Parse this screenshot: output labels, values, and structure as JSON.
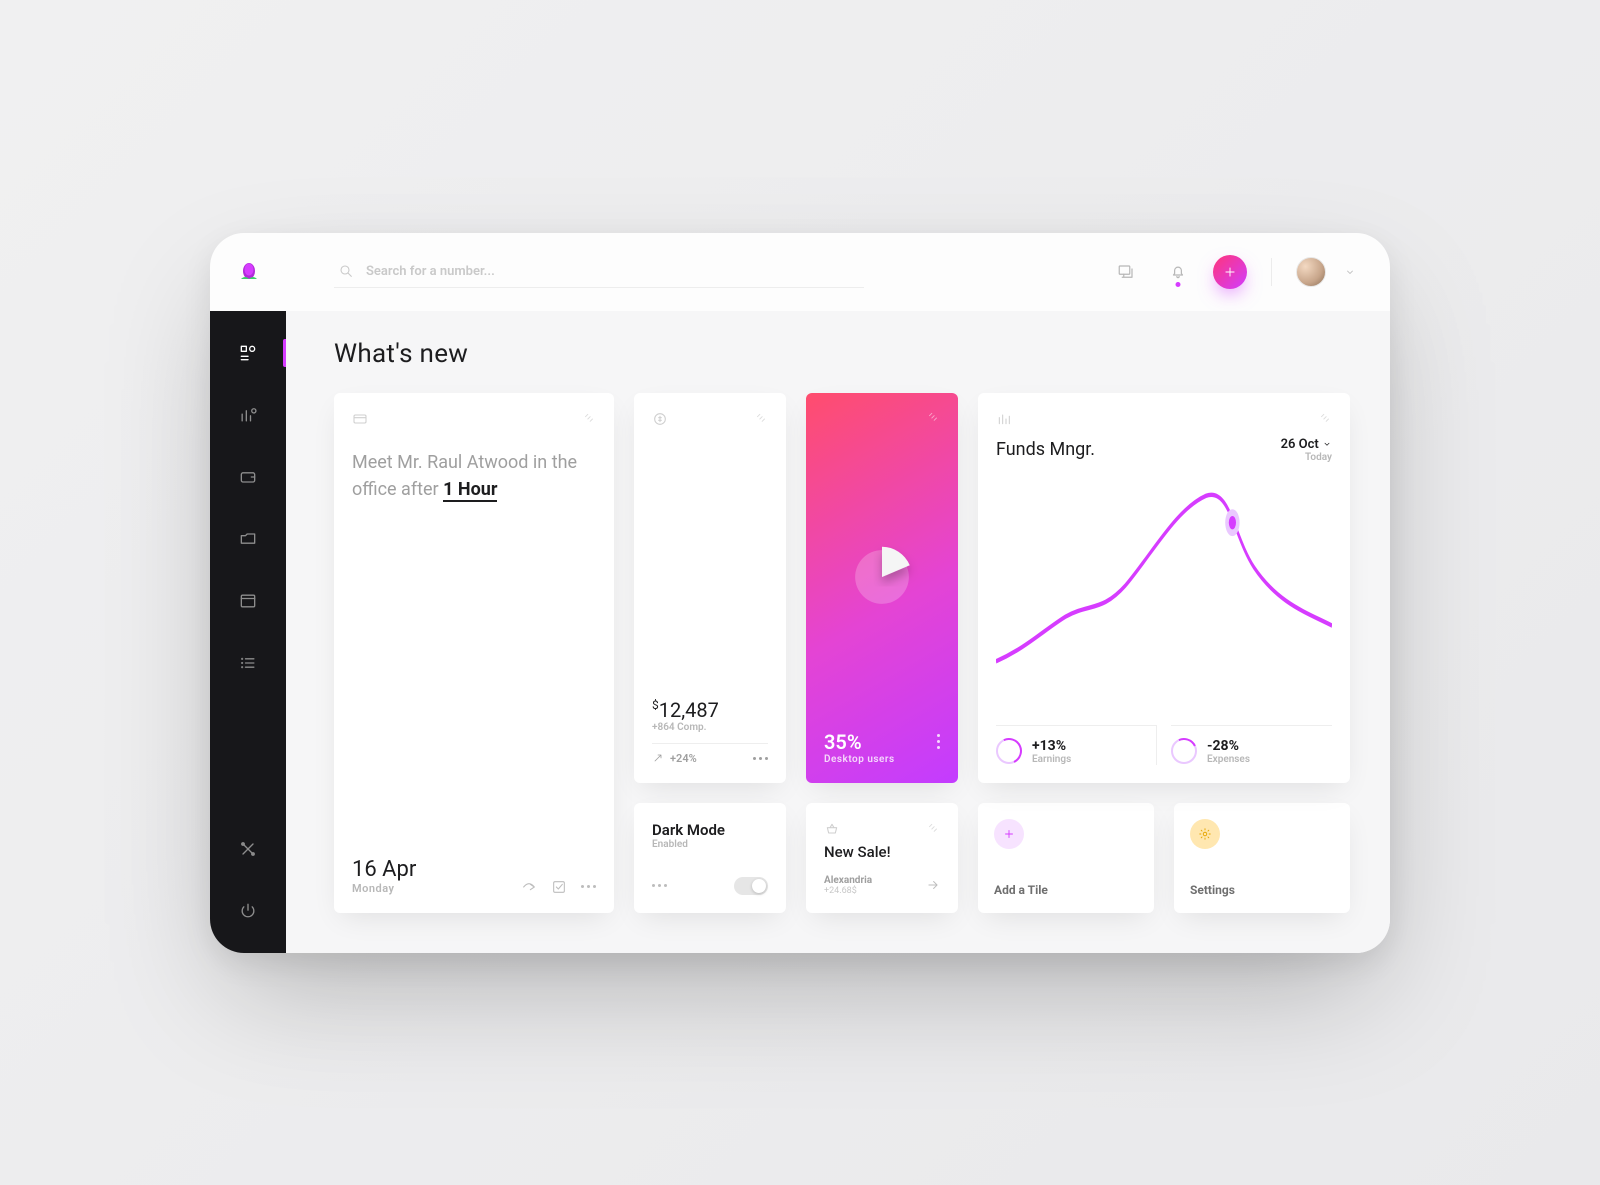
{
  "colors": {
    "accent": "#d63cff",
    "accentSoft": "#f7e3ff",
    "gold": "#e5a500",
    "goldSoft": "#ffe7b0"
  },
  "search": {
    "placeholder": "Search for a number..."
  },
  "header": {
    "page_title": "What's new"
  },
  "meeting": {
    "prefix": "Meet Mr. Raul Atwood in the office after ",
    "emphasis": "1 Hour",
    "date": "16 Apr",
    "day": "Monday"
  },
  "money": {
    "currency": "$",
    "amount": "12,487",
    "subline": "+864 Comp.",
    "trend": "+24%"
  },
  "darkmode": {
    "title": "Dark Mode",
    "state": "Enabled",
    "on": true
  },
  "pie": {
    "value": "35%",
    "label": "Desktop users",
    "slice_percent": 35
  },
  "sale": {
    "title": "New Sale!",
    "location": "Alexandria",
    "amount": "+24.68$"
  },
  "funds": {
    "title": "Funds Mngr.",
    "date": "26 Oct",
    "date_sub": "Today",
    "earnings": {
      "value": "+13%",
      "label": "Earnings"
    },
    "expenses": {
      "value": "-28%",
      "label": "Expenses"
    }
  },
  "tiles": {
    "add": "Add a Tile",
    "settings": "Settings"
  },
  "chart_data": {
    "type": "line",
    "title": "Funds Mngr.",
    "xlabel": "",
    "ylabel": "",
    "x": [
      0,
      1,
      2,
      3,
      4,
      5,
      6,
      7,
      8,
      9,
      10,
      11,
      12
    ],
    "values": [
      20,
      26,
      34,
      38,
      36,
      44,
      60,
      74,
      82,
      70,
      54,
      48,
      42
    ],
    "ylim": [
      0,
      100
    ],
    "marker_index": 9,
    "annotations": [
      "26 Oct",
      "Today"
    ]
  }
}
